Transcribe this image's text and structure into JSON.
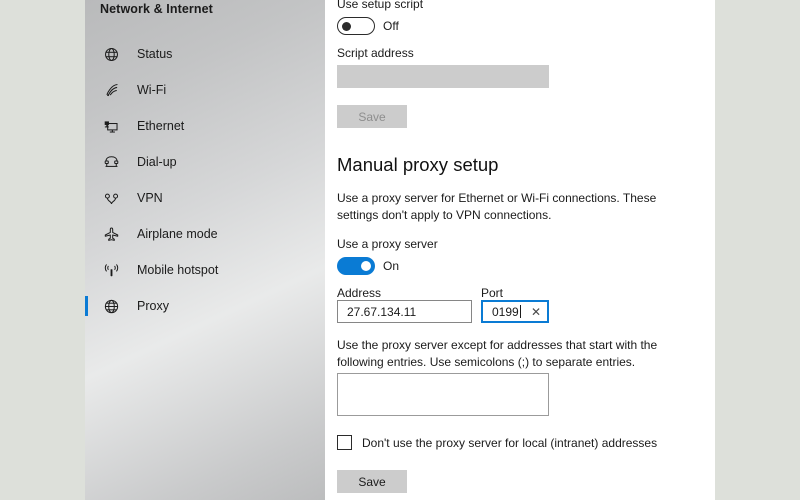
{
  "window": {
    "page_background": "#dde0da",
    "accent_color": "#0a7bd4"
  },
  "sidebar": {
    "title": "Network & Internet",
    "items": [
      {
        "label": "Status",
        "icon": "globe-status-icon",
        "selected": false
      },
      {
        "label": "Wi-Fi",
        "icon": "wifi-icon",
        "selected": false
      },
      {
        "label": "Ethernet",
        "icon": "ethernet-icon",
        "selected": false
      },
      {
        "label": "Dial-up",
        "icon": "dialup-phone-icon",
        "selected": false
      },
      {
        "label": "VPN",
        "icon": "vpn-icon",
        "selected": false
      },
      {
        "label": "Airplane mode",
        "icon": "airplane-icon",
        "selected": false
      },
      {
        "label": "Mobile hotspot",
        "icon": "mobile-hotspot-icon",
        "selected": false
      },
      {
        "label": "Proxy",
        "icon": "proxy-globe-icon",
        "selected": true
      }
    ]
  },
  "setup_script": {
    "heading": "Use setup script",
    "toggle_state": "Off",
    "script_address_label": "Script address",
    "script_address_value": "",
    "save_label": "Save",
    "save_enabled": false
  },
  "manual_proxy": {
    "heading": "Manual proxy setup",
    "description": "Use a proxy server for Ethernet or Wi-Fi connections. These settings don't apply to VPN connections.",
    "use_proxy_label": "Use a proxy server",
    "toggle_state": "On",
    "address_label": "Address",
    "address_value": "27.67.134.11",
    "port_label": "Port",
    "port_value": "0199",
    "port_clear_icon": "close-x-icon",
    "exceptions_description": "Use the proxy server except for addresses that start with the following entries. Use semicolons (;) to separate entries.",
    "exceptions_value": "",
    "bypass_local_label": "Don't use the proxy server for local (intranet) addresses",
    "bypass_local_checked": false,
    "save_label": "Save",
    "save_enabled": true
  }
}
